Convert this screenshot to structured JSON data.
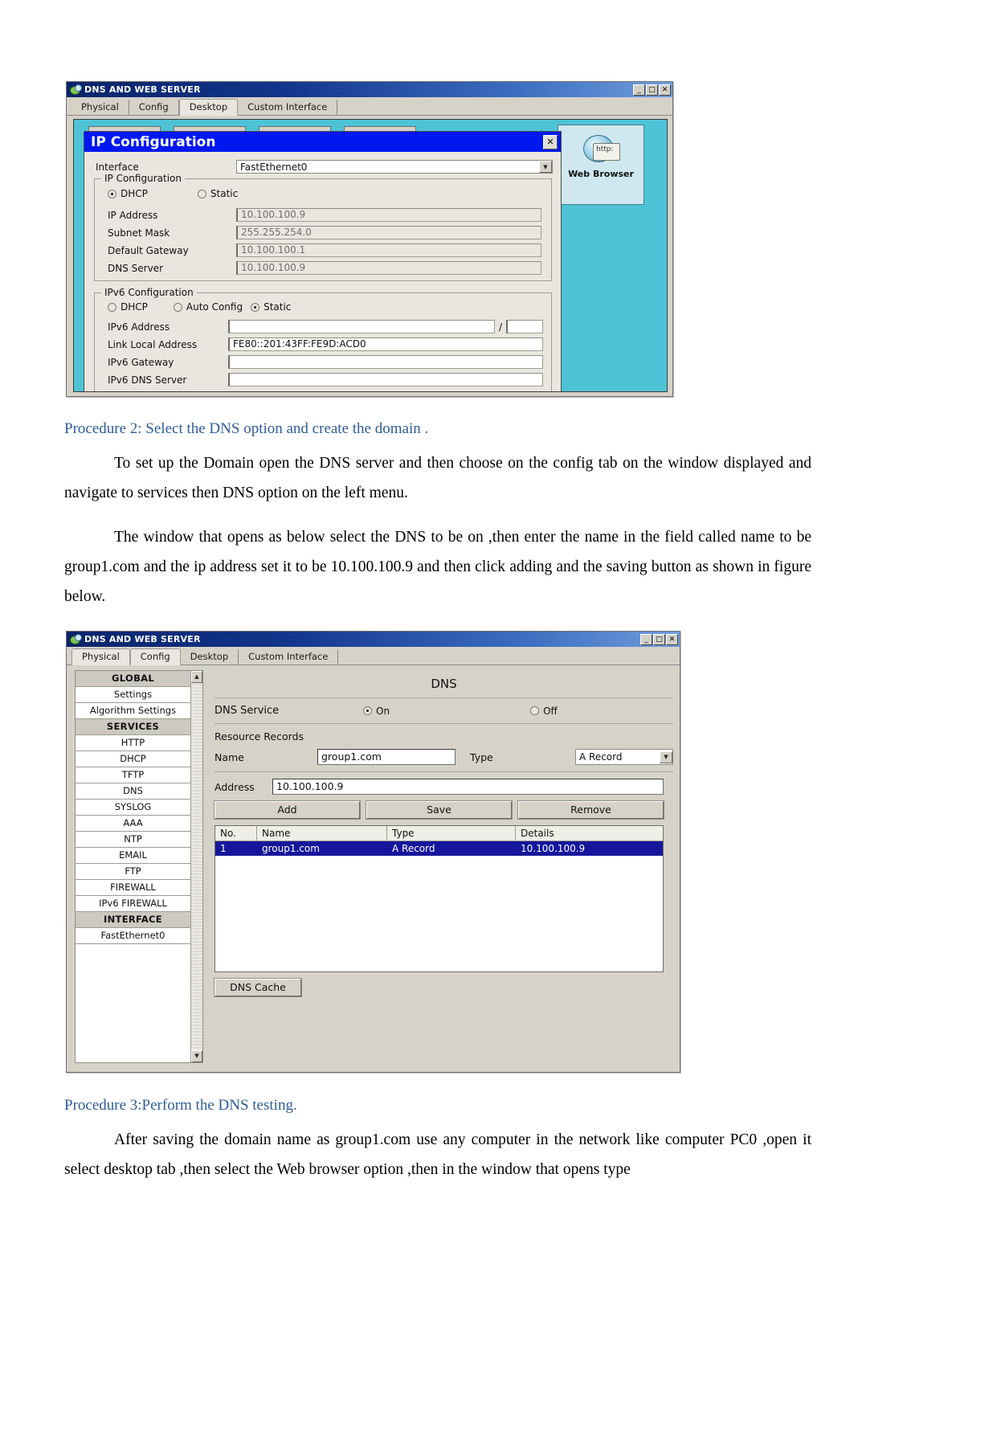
{
  "document": {
    "procedure2_heading": "Procedure 2: Select the DNS option and create the domain .",
    "para1": "To set up the Domain open the DNS server and then choose on the config tab on the window displayed and  navigate to services then DNS option on the left menu.",
    "para2": "The window that opens as below select the DNS to be on ,then enter the name in the field called name  to be  group1.com and the ip address set it to be 10.100.100.9 and then click adding  and the saving button as shown in figure below.",
    "procedure3_heading": "Procedure 3:Perform the DNS testing.",
    "para3": "After saving the domain name as group1.com use any computer in the network like computer PC0 ,open it select desktop tab ,then select the Web browser option ,then in the window that opens type"
  },
  "window_ipconfig": {
    "title": "DNS AND WEB SERVER",
    "caption_buttons": [
      "_",
      "□",
      "✕"
    ],
    "tabs": [
      {
        "label": "Physical",
        "selected": false
      },
      {
        "label": "Config",
        "selected": false
      },
      {
        "label": "Desktop",
        "selected": true
      },
      {
        "label": "Custom Interface",
        "selected": false
      }
    ],
    "browser_tile": {
      "label": "Web Browser",
      "url_text": "http:"
    },
    "dialog": {
      "title": "IP Configuration",
      "close_label": "✕",
      "interface_label": "Interface",
      "interface_value": "FastEthernet0",
      "ipv4_group_title": "IP Configuration",
      "ipv4_modes": [
        {
          "label": "DHCP",
          "selected": true
        },
        {
          "label": "Static",
          "selected": false
        }
      ],
      "fields": [
        {
          "label": "IP Address",
          "value": "10.100.100.9"
        },
        {
          "label": "Subnet Mask",
          "value": "255.255.254.0"
        },
        {
          "label": "Default Gateway",
          "value": "10.100.100.1"
        },
        {
          "label": "DNS Server",
          "value": "10.100.100.9"
        }
      ],
      "ipv6_group_title": "IPv6 Configuration",
      "ipv6_modes": [
        {
          "label": "DHCP",
          "selected": false
        },
        {
          "label": "Auto Config",
          "selected": false
        },
        {
          "label": "Static",
          "selected": true
        }
      ],
      "ipv6_address_label": "IPv6 Address",
      "ipv6_address_value": "",
      "ipv6_prefix_separator": "/",
      "ipv6_prefix_value": "",
      "link_local_label": "Link Local Address",
      "link_local_value": "FE80::201:43FF:FE9D:ACD0",
      "ipv6_gateway_label": "IPv6 Gateway",
      "ipv6_gateway_value": "",
      "ipv6_dns_label": "IPv6 DNS Server",
      "ipv6_dns_value": ""
    }
  },
  "window_dns": {
    "title": "DNS AND WEB SERVER",
    "caption_buttons": [
      "_",
      "□",
      "✕"
    ],
    "tabs": [
      {
        "label": "Physical",
        "selected": false
      },
      {
        "label": "Config",
        "selected": true
      },
      {
        "label": "Desktop",
        "selected": false
      },
      {
        "label": "Custom Interface",
        "selected": false
      }
    ],
    "nav": [
      {
        "label": "GLOBAL",
        "header": true
      },
      {
        "label": "Settings",
        "header": false
      },
      {
        "label": "Algorithm Settings",
        "header": false
      },
      {
        "label": "SERVICES",
        "header": true
      },
      {
        "label": "HTTP",
        "header": false
      },
      {
        "label": "DHCP",
        "header": false
      },
      {
        "label": "TFTP",
        "header": false
      },
      {
        "label": "DNS",
        "header": false
      },
      {
        "label": "SYSLOG",
        "header": false
      },
      {
        "label": "AAA",
        "header": false
      },
      {
        "label": "NTP",
        "header": false
      },
      {
        "label": "EMAIL",
        "header": false
      },
      {
        "label": "FTP",
        "header": false
      },
      {
        "label": "FIREWALL",
        "header": false
      },
      {
        "label": "IPv6 FIREWALL",
        "header": false
      },
      {
        "label": "INTERFACE",
        "header": true
      },
      {
        "label": "FastEthernet0",
        "header": false
      }
    ],
    "nav_scroll": {
      "up": "▲",
      "down": "▼"
    },
    "panel_title": "DNS",
    "service_label": "DNS Service",
    "service_options": [
      {
        "label": "On",
        "selected": true
      },
      {
        "label": "Off",
        "selected": false
      }
    ],
    "records_label": "Resource Records",
    "name_label": "Name",
    "name_value": "group1.com",
    "type_label": "Type",
    "type_value": "A Record",
    "type_arrow": "▼",
    "address_label": "Address",
    "address_value": "10.100.100.9",
    "buttons": [
      "Add",
      "Save",
      "Remove"
    ],
    "table": {
      "columns": [
        "No.",
        "Name",
        "Type",
        "Details"
      ],
      "rows": [
        {
          "no": "1",
          "name": "group1.com",
          "type": "A Record",
          "details": "10.100.100.9"
        }
      ]
    },
    "cache_button": "DNS Cache"
  },
  "colors": {
    "title_bar_start": "#0a246a",
    "title_bar_end": "#6f9ddd",
    "dialog_header_blue": "#0018f0",
    "desktop_teal": "#4ec3d6",
    "selected_row_blue": "#16169c",
    "heading_blue": "#2e5c9a",
    "window_gray": "#d6d2c8"
  }
}
